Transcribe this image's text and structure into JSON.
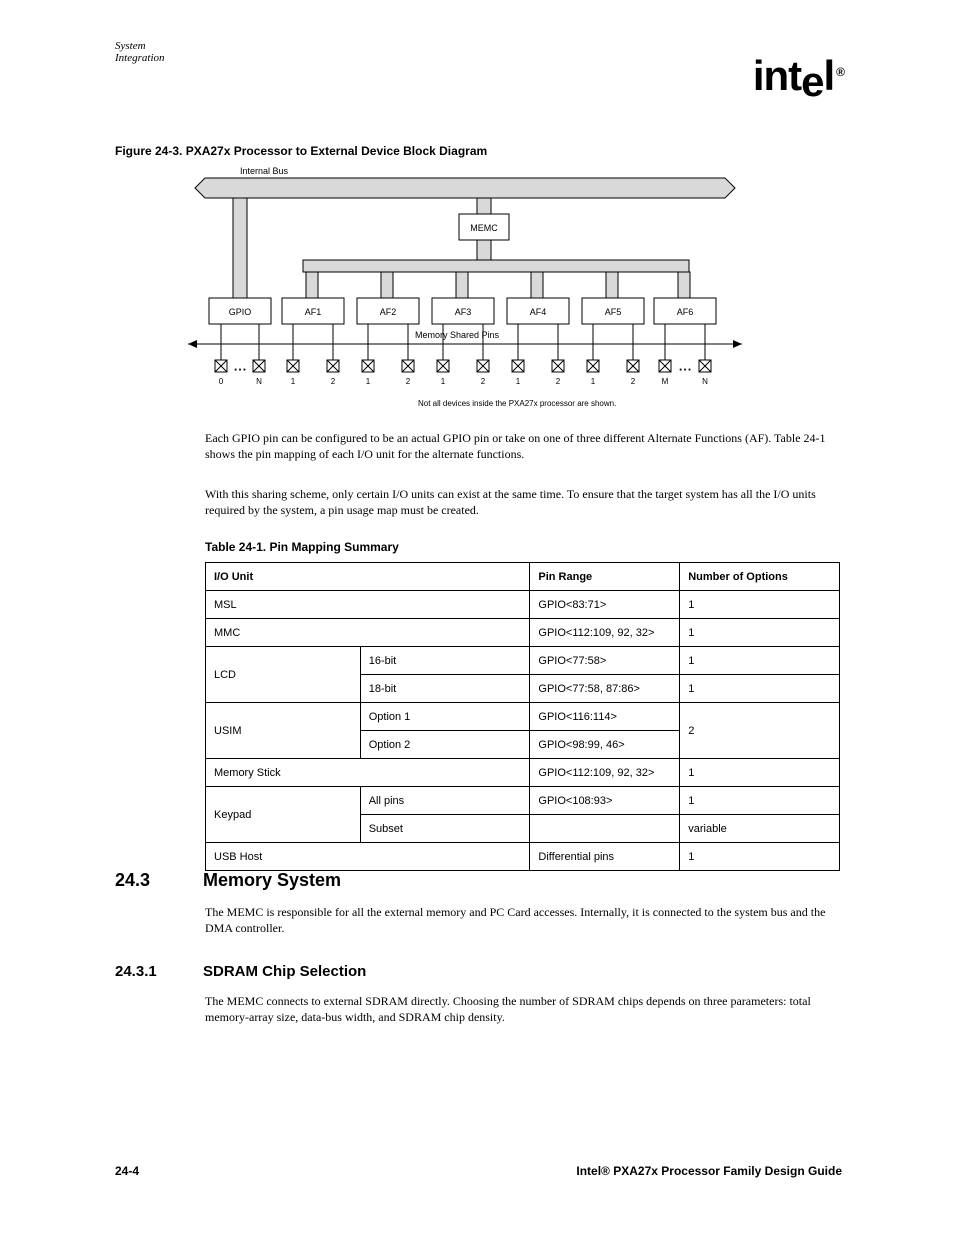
{
  "header": {
    "section_title": "System Integration"
  },
  "logo": {
    "text_a": "int",
    "text_e": "e",
    "text_l": "l",
    "r": "®"
  },
  "figure": {
    "title": "Figure 24-3.  PXA27x Processor to External Device Block Diagram",
    "bus_top": "Internal Bus",
    "memc": "MEMC",
    "pins_label": "Memory Shared Pins",
    "blocks": [
      "GPIO",
      "AF1",
      "AF2",
      "AF3",
      "AF4",
      "AF5",
      "AF6"
    ],
    "af_pins": [
      "1",
      "2",
      "1",
      "2",
      "1",
      "2",
      "1",
      "2",
      "1",
      "2",
      "M",
      "N"
    ],
    "gpio_pins": [
      "0",
      "N"
    ],
    "note": "Not all devices inside the PXA27x processor are shown."
  },
  "paragraphs": {
    "p1": "Each GPIO pin can be configured to be an actual GPIO pin or take on one of three different Alternate Functions (AF). Table 24-1 shows the pin mapping of each I/O unit for the alternate functions.",
    "p2": "With this sharing scheme, only certain I/O units can exist at the same time. To ensure that the target system has all the I/O units required by the system, a pin usage map must be created.",
    "p3": "The MEMC is responsible for all the external memory and PC Card accesses. Internally, it is connected to the system bus and the DMA controller.",
    "p4": "The MEMC connects to external SDRAM directly. Choosing the number of SDRAM chips depends on three parameters: total memory-array size, data-bus width, and SDRAM chip density."
  },
  "table": {
    "title": "Table 24-1.  Pin Mapping Summary",
    "headers": [
      "I/O Unit",
      "Pin Range",
      "Number of Options"
    ],
    "rows": [
      {
        "c1": "MSL",
        "c2": "",
        "c3": "GPIO<83:71>",
        "c4": "1"
      },
      {
        "c1": "MMC",
        "c2": "",
        "c3": "GPIO<112:109, 92, 32>",
        "c4": "1"
      },
      {
        "c1": "LCD",
        "c2": "16-bit",
        "c3": "GPIO<77:58>",
        "c4": "1",
        "rowspan": 2
      },
      {
        "c2": "18-bit",
        "c3": "GPIO<77:58, 87:86>",
        "c4": "1"
      },
      {
        "c1": "USIM",
        "c2": "Option 1",
        "c3": "GPIO<116:114>",
        "c4": "2",
        "rowspan": 2
      },
      {
        "c2": "Option 2",
        "c3": "GPIO<98:99, 46>",
        "c4": ""
      },
      {
        "c1": "Memory Stick",
        "c2": "",
        "c3": "GPIO<112:109, 92, 32>",
        "c4": "1"
      },
      {
        "c1": "Keypad",
        "c2": "All pins",
        "c3": "GPIO<108:93>",
        "c4": "1",
        "rowspan": 2
      },
      {
        "c2": "Subset",
        "c3": "",
        "c4": "variable"
      },
      {
        "c1": "USB Host",
        "c2": "",
        "c3": "Differential pins",
        "c4": "1"
      }
    ]
  },
  "headings": {
    "h243_num": "24.3",
    "h243_text": "Memory System",
    "h2431_num": "24.3.1",
    "h2431_text": "SDRAM Chip Selection"
  },
  "footer": {
    "page": "24-4",
    "book": "Intel® PXA27x Processor Family Design Guide"
  }
}
